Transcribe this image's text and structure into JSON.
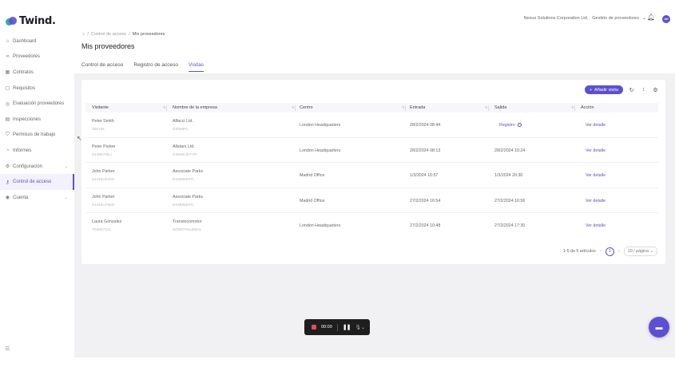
{
  "app": {
    "brand": "Twind."
  },
  "sidebar": {
    "items": [
      {
        "label": "Dashboard",
        "icon": "home-icon",
        "glyph": "⌂"
      },
      {
        "label": "Proveedores",
        "icon": "link-icon",
        "glyph": "∞"
      },
      {
        "label": "Contratos",
        "icon": "grid-icon",
        "glyph": "▦"
      },
      {
        "label": "Requisitos",
        "icon": "document-icon",
        "glyph": "▢"
      },
      {
        "label": "Evaluación proveedores",
        "icon": "check-circle-icon",
        "glyph": "◎"
      },
      {
        "label": "Inspecciones",
        "icon": "clipboard-icon",
        "glyph": "▤"
      },
      {
        "label": "Permisos de trabajo",
        "icon": "shield-icon",
        "glyph": "⛉"
      },
      {
        "label": "Informes",
        "icon": "chart-icon",
        "glyph": "◔"
      },
      {
        "label": "Configuración",
        "icon": "gear-icon",
        "glyph": "⚙",
        "has_chevron": true
      },
      {
        "label": "Control de acceso",
        "icon": "key-icon",
        "glyph": "⚷",
        "active": true
      },
      {
        "label": "Cuenta",
        "icon": "user-icon",
        "glyph": "◉",
        "has_chevron": true
      }
    ]
  },
  "header": {
    "org": "Nexus Solutions Corporation Ltd. · Gestión de proveedores",
    "avatar_initials": "AH"
  },
  "breadcrumb": [
    "Control de acceso",
    "Mis proveedores"
  ],
  "page": {
    "title": "Mis proveedores",
    "tabs": [
      {
        "label": "Control de acceso"
      },
      {
        "label": "Registro de acceso"
      },
      {
        "label": "Visitas",
        "active": true
      }
    ]
  },
  "toolbar": {
    "add_label": "Añadir visita"
  },
  "table": {
    "columns": [
      "Visitante",
      "Nombre de la empresa",
      "Centro",
      "Entrada",
      "Salida",
      "Acción"
    ],
    "rows": [
      {
        "visitor": "Peter Smith",
        "visitor_id": "4657BL",
        "company": "Alfacci Ltd.",
        "company_id": "D4569PL",
        "centro": "London Headquarters",
        "entrada": "28/2/2024 08:44",
        "salida": "Registro",
        "salida_is_link": true,
        "accion": "Ver detalle"
      },
      {
        "visitor": "Peter Parker",
        "visitor_id": "44495785U",
        "company": "Allstars Ltd.",
        "company_id": "G4556UETYP",
        "centro": "London Headquarters",
        "entrada": "28/2/2024 08:13",
        "salida": "28/2/2024 10:24",
        "accion": "Ver detalle"
      },
      {
        "visitor": "John Parker",
        "visitor_id": "44445U015G",
        "company": "Associate Parks",
        "company_id": "D4469920TL",
        "centro": "Madrid Office",
        "entrada": "1/3/2024 16:57",
        "salida": "1/3/2024 20:30",
        "accion": "Ver detalle"
      },
      {
        "visitor": "John Parker",
        "visitor_id": "44445U795G",
        "company": "Associate Parks",
        "company_id": "D4469920TL",
        "centro": "Madrid Office",
        "entrada": "27/2/2024 16:54",
        "salida": "27/2/2024 16:56",
        "accion": "Ver detalle"
      },
      {
        "visitor": "Laura Gonzalez",
        "visitor_id": "T0400712L",
        "company": "Translocomotor",
        "company_id": "W0597041ZMHL",
        "centro": "London Headquarters",
        "entrada": "27/2/2024 10:48",
        "salida": "27/2/2024 17:30",
        "accion": "Ver detalle"
      }
    ]
  },
  "pagination": {
    "summary": "1-5 de 5 artículos",
    "page": "1",
    "page_size": "10 / página"
  },
  "recorder": {
    "time": "00:00"
  },
  "colors": {
    "accent": "#5b4fd6",
    "record": "#e84a5f",
    "brand_teal": "#2bb1a8"
  }
}
